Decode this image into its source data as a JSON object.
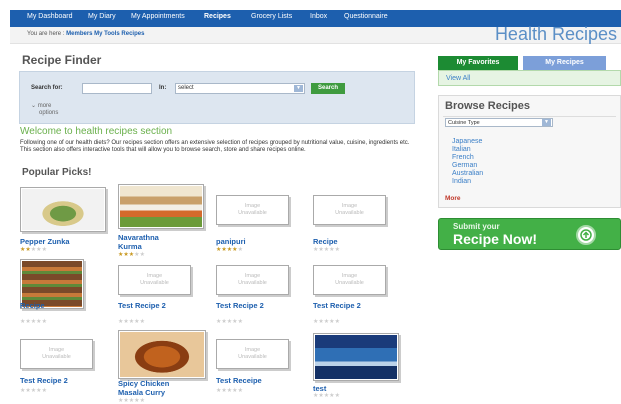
{
  "nav": {
    "items": [
      {
        "label": "My Dashboard"
      },
      {
        "label": "My Diary"
      },
      {
        "label": "My Appointments"
      },
      {
        "label": "Recipes"
      },
      {
        "label": "Grocery Lists"
      },
      {
        "label": "Inbox"
      },
      {
        "label": "Questionnaire"
      }
    ],
    "active": "Recipes"
  },
  "breadcrumb": {
    "prefix": "You are here :",
    "items": [
      "Members",
      "My Tools",
      "Recipes"
    ]
  },
  "site_title": "Health Recipes",
  "finder": {
    "title": "Recipe Finder",
    "search_label": "Search for:",
    "search_value": "",
    "in_label": "In:",
    "in_select": "select",
    "search_button": "Search",
    "more_options_1": "more",
    "more_options_2": "options"
  },
  "welcome": {
    "heading": "Welcome to health recipes section",
    "text": "Following one of our health diets? Our recipes section offers an extensive selection of recipes grouped by nutritional value, cuisine, ingredients etc. This section also offers interactive tools that will allow you to browse search, store and share recipes online."
  },
  "popular_title": "Popular Picks!",
  "image_unavailable": {
    "line1": "Image",
    "line2": "Unavailable"
  },
  "recipes": [
    {
      "title": "Pepper Zunka",
      "title2": "",
      "rating": 2,
      "has_image": true,
      "image": "pepper-zunka"
    },
    {
      "title": "Navarathna",
      "title2": "Kurma",
      "rating": 3,
      "has_image": true,
      "image": "navarathna-kurma"
    },
    {
      "title": "panipuri",
      "title2": "",
      "rating": 4,
      "has_image": false,
      "image": ""
    },
    {
      "title": "Recipe",
      "title2": "",
      "rating": 0,
      "has_image": false,
      "image": ""
    },
    {
      "title": "Recipe",
      "title2": "",
      "rating": 0,
      "has_image": true,
      "image": "recipe"
    },
    {
      "title": "Test Recipe 2",
      "title2": "",
      "rating": 0,
      "has_image": false,
      "image": ""
    },
    {
      "title": "Test Recipe 2",
      "title2": "",
      "rating": 0,
      "has_image": false,
      "image": ""
    },
    {
      "title": "Test Recipe 2",
      "title2": "",
      "rating": 0,
      "has_image": false,
      "image": ""
    },
    {
      "title": "Test Recipe 2",
      "title2": "",
      "rating": 0,
      "has_image": false,
      "image": ""
    },
    {
      "title": "Spicy Chicken",
      "title2": "Masala Curry",
      "rating": 0,
      "has_image": true,
      "image": "spicy-chicken"
    },
    {
      "title": "Test Receipe",
      "title2": "",
      "rating": 0,
      "has_image": false,
      "image": ""
    },
    {
      "title": "test",
      "title2": "",
      "rating": 0,
      "has_image": true,
      "image": "test"
    }
  ],
  "sidebar": {
    "tabs": [
      {
        "label": "My Favorites",
        "active": true
      },
      {
        "label": "My Recipes",
        "active": false
      }
    ],
    "view_all": "View All",
    "browse_title": "Browse Recipes",
    "cuisine_select": "Cuisine Type",
    "cuisines": [
      "Japanese",
      "Italian",
      "French",
      "German",
      "Australian",
      "Indian"
    ],
    "more": "More"
  },
  "submit_banner": {
    "line1": "Submit your",
    "line2": "Recipe Now!"
  },
  "colors": {
    "nav_blue": "#1d5fae",
    "accent_green": "#3f9b3f",
    "link_blue": "#1d5fae",
    "star_gold": "#c99a23"
  }
}
